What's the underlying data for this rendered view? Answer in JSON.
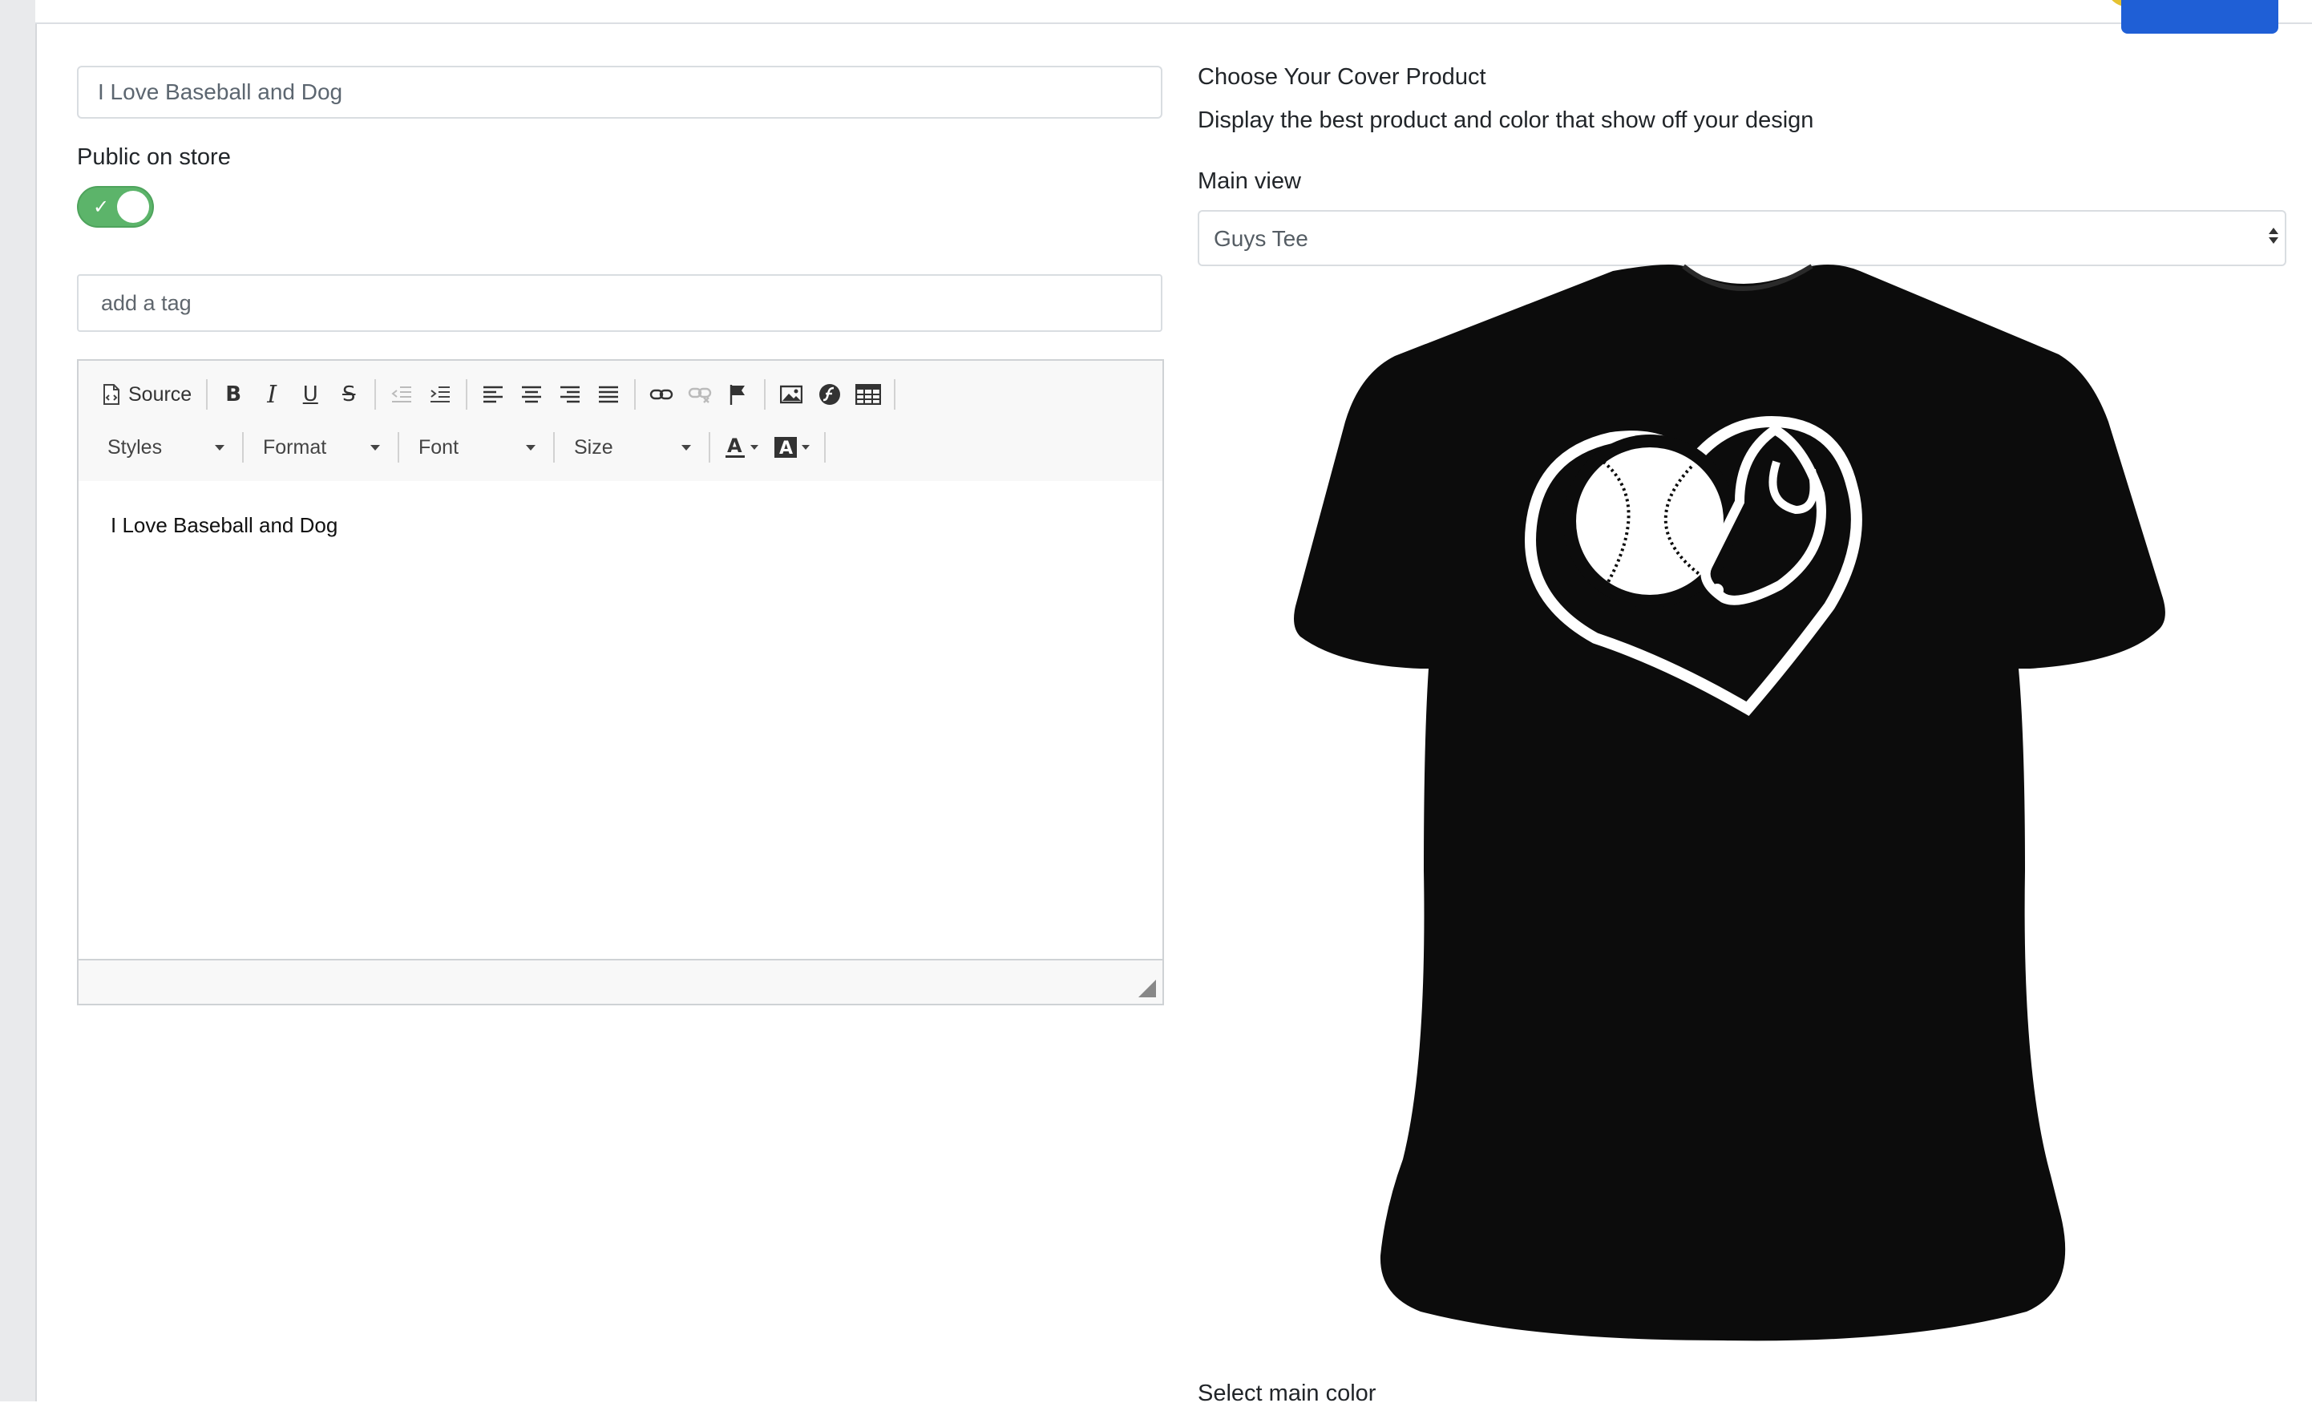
{
  "product": {
    "title_value": "I Love Baseball and Dog",
    "public_label": "Public on store",
    "public_on": true,
    "tag_placeholder": "add a tag"
  },
  "editor": {
    "toolbar": {
      "source_label": "Source",
      "buttons": [
        "bold",
        "italic",
        "underline",
        "strikethrough",
        "outdent",
        "indent",
        "align-left",
        "align-center",
        "align-right",
        "justify",
        "link",
        "unlink",
        "anchor",
        "image",
        "flash",
        "table"
      ],
      "styles_label": "Styles",
      "format_label": "Format",
      "font_label": "Font",
      "size_label": "Size",
      "text_color_icon": "text-color-icon",
      "bg_color_icon": "background-color-icon"
    },
    "content": "I Love Baseball and Dog"
  },
  "cover": {
    "heading": "Choose Your Cover Product",
    "subtext": "Display the best product and color that show off your design",
    "main_view_label": "Main view",
    "main_view_value": "Guys Tee",
    "main_view_options": [
      "Guys Tee"
    ],
    "select_color_label": "Select main color",
    "preview_image": "t-shirt-preview",
    "shirt_color": "#0c0c0c"
  },
  "colors": {
    "toggle_on": "#5cb46a",
    "accent_blue": "#1f5fd6",
    "avatar_yellow": "#e5c231"
  }
}
